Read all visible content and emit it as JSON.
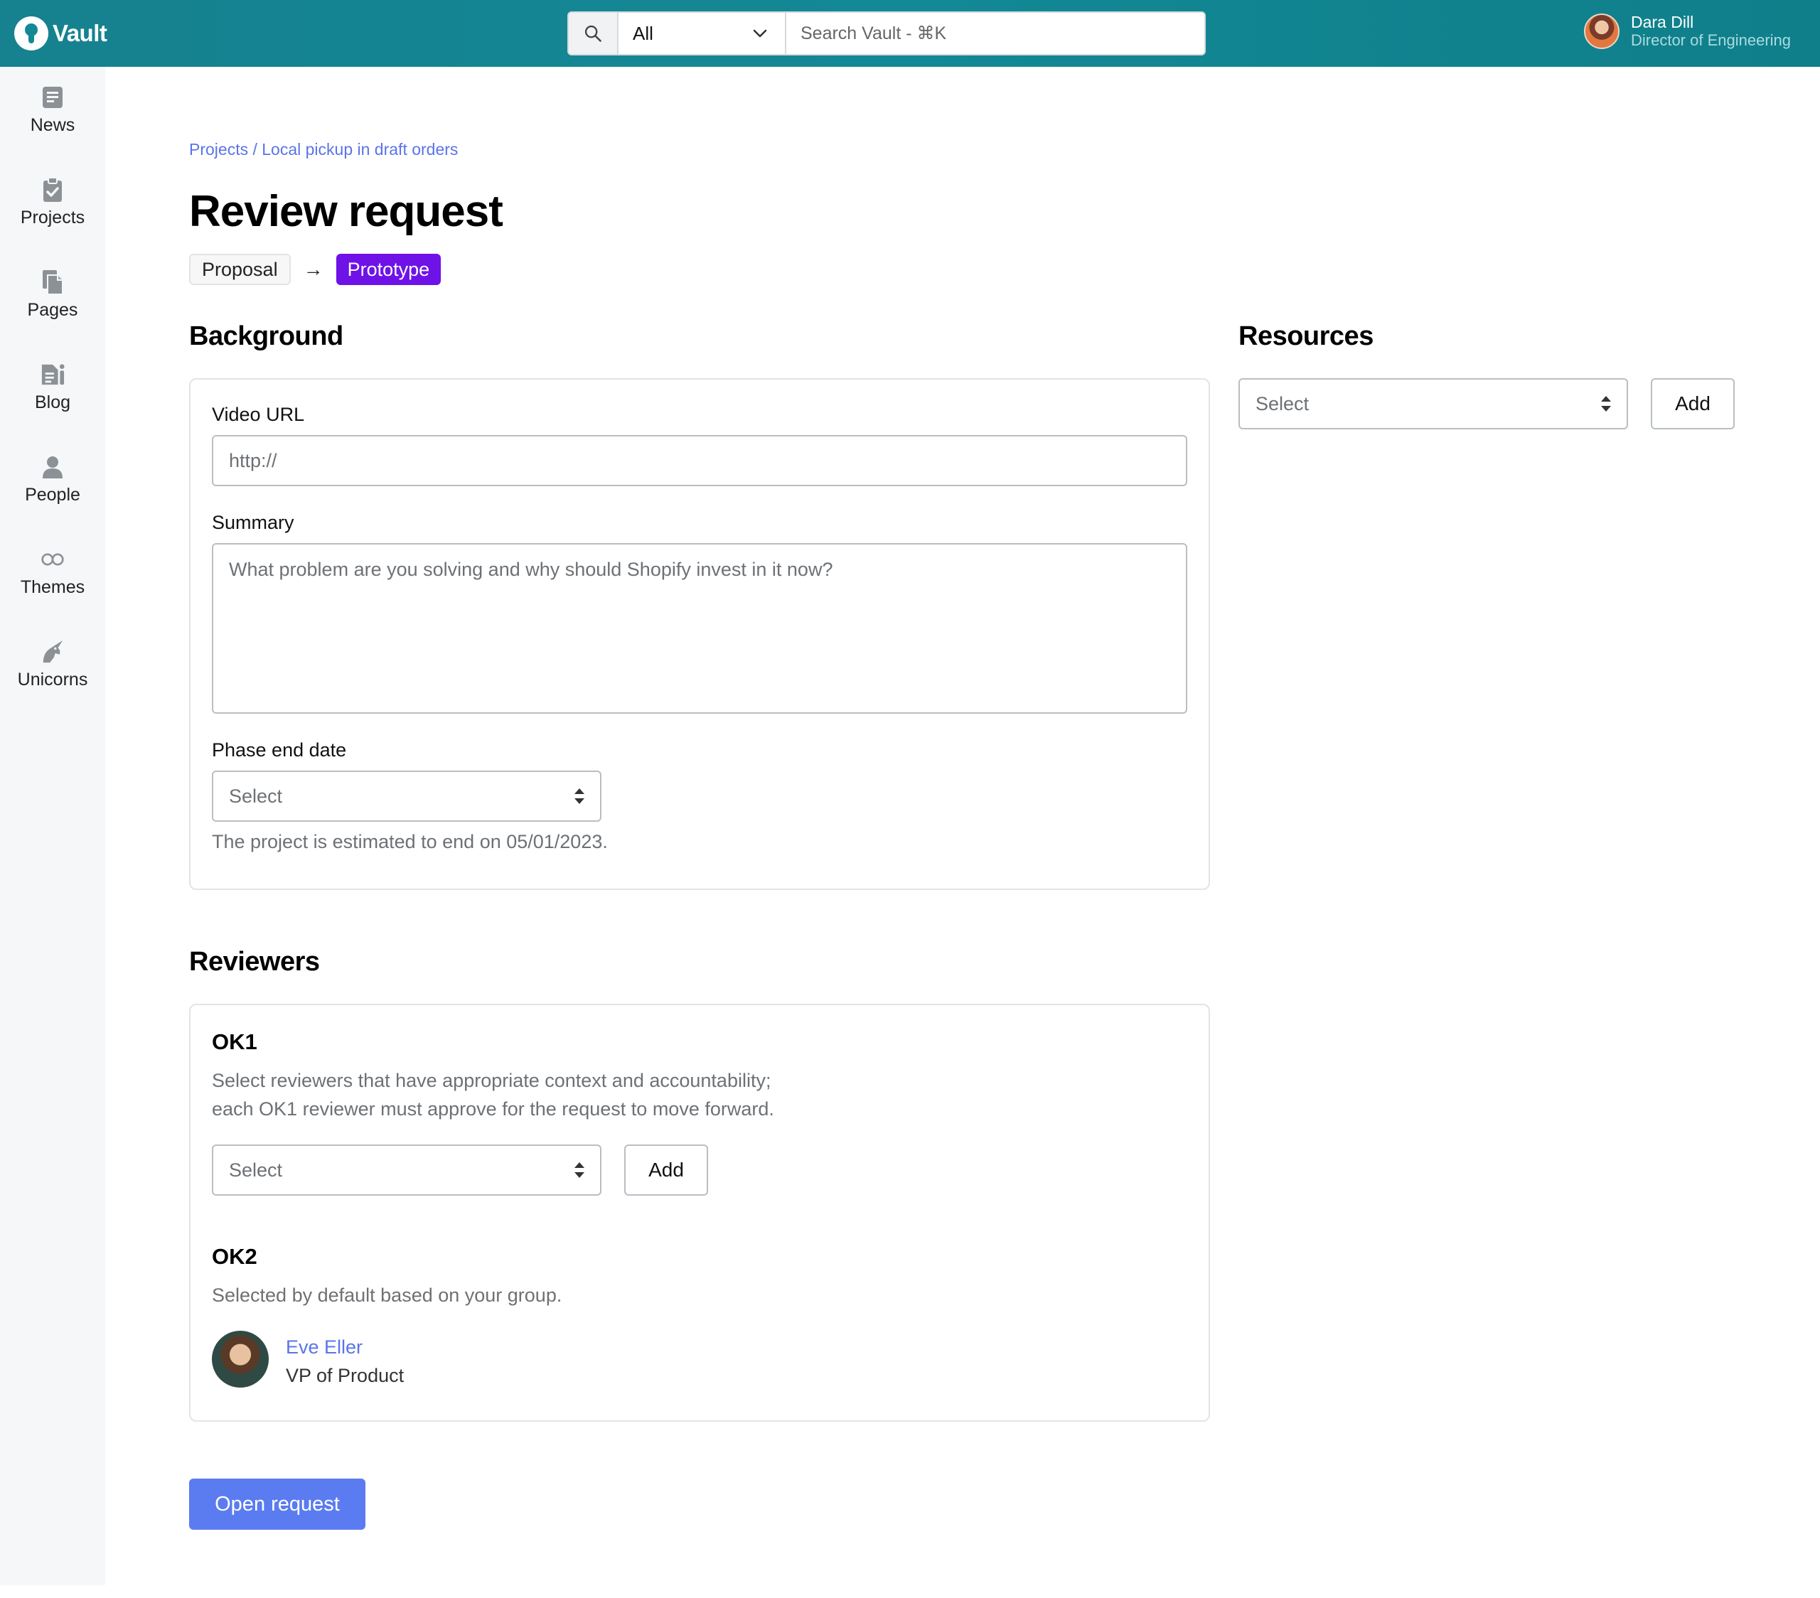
{
  "app": {
    "name": "Vault"
  },
  "search": {
    "scope_value": "All",
    "placeholder": "Search Vault - ⌘K"
  },
  "user": {
    "name": "Dara Dill",
    "role": "Director of Engineering"
  },
  "sidebar": {
    "items": [
      {
        "label": "News",
        "icon": "news-icon"
      },
      {
        "label": "Projects",
        "icon": "clipboard-check-icon"
      },
      {
        "label": "Pages",
        "icon": "pages-icon"
      },
      {
        "label": "Blog",
        "icon": "blog-icon"
      },
      {
        "label": "People",
        "icon": "person-icon"
      },
      {
        "label": "Themes",
        "icon": "infinity-icon"
      },
      {
        "label": "Unicorns",
        "icon": "unicorn-icon"
      }
    ]
  },
  "breadcrumb": {
    "parent": "Projects",
    "separator": " / ",
    "current": "Local pickup in draft orders"
  },
  "page": {
    "title": "Review request"
  },
  "phase": {
    "from": "Proposal",
    "arrow": "→",
    "to": "Prototype"
  },
  "background": {
    "heading": "Background",
    "video_url_label": "Video URL",
    "video_url_placeholder": "http://",
    "summary_label": "Summary",
    "summary_placeholder": "What problem are you solving and why should Shopify invest in it now?",
    "phase_end_label": "Phase end date",
    "phase_end_value": "Select",
    "phase_end_help": "The project is estimated to end on 05/01/2023."
  },
  "resources": {
    "heading": "Resources",
    "select_value": "Select",
    "add_label": "Add"
  },
  "reviewers": {
    "heading": "Reviewers",
    "ok1": {
      "title": "OK1",
      "help_line1": "Select reviewers that have appropriate context and accountability;",
      "help_line2": "each OK1 reviewer must approve for the request to move forward.",
      "select_value": "Select",
      "add_label": "Add"
    },
    "ok2": {
      "title": "OK2",
      "help": "Selected by default based on your group.",
      "reviewer_name": "Eve Eller",
      "reviewer_role": "VP of Product"
    }
  },
  "actions": {
    "open_request": "Open request"
  },
  "colors": {
    "header": "#138896",
    "accent_link": "#5b74e8",
    "prototype_pill": "#6f12e8",
    "primary_button": "#5b7cf0"
  }
}
